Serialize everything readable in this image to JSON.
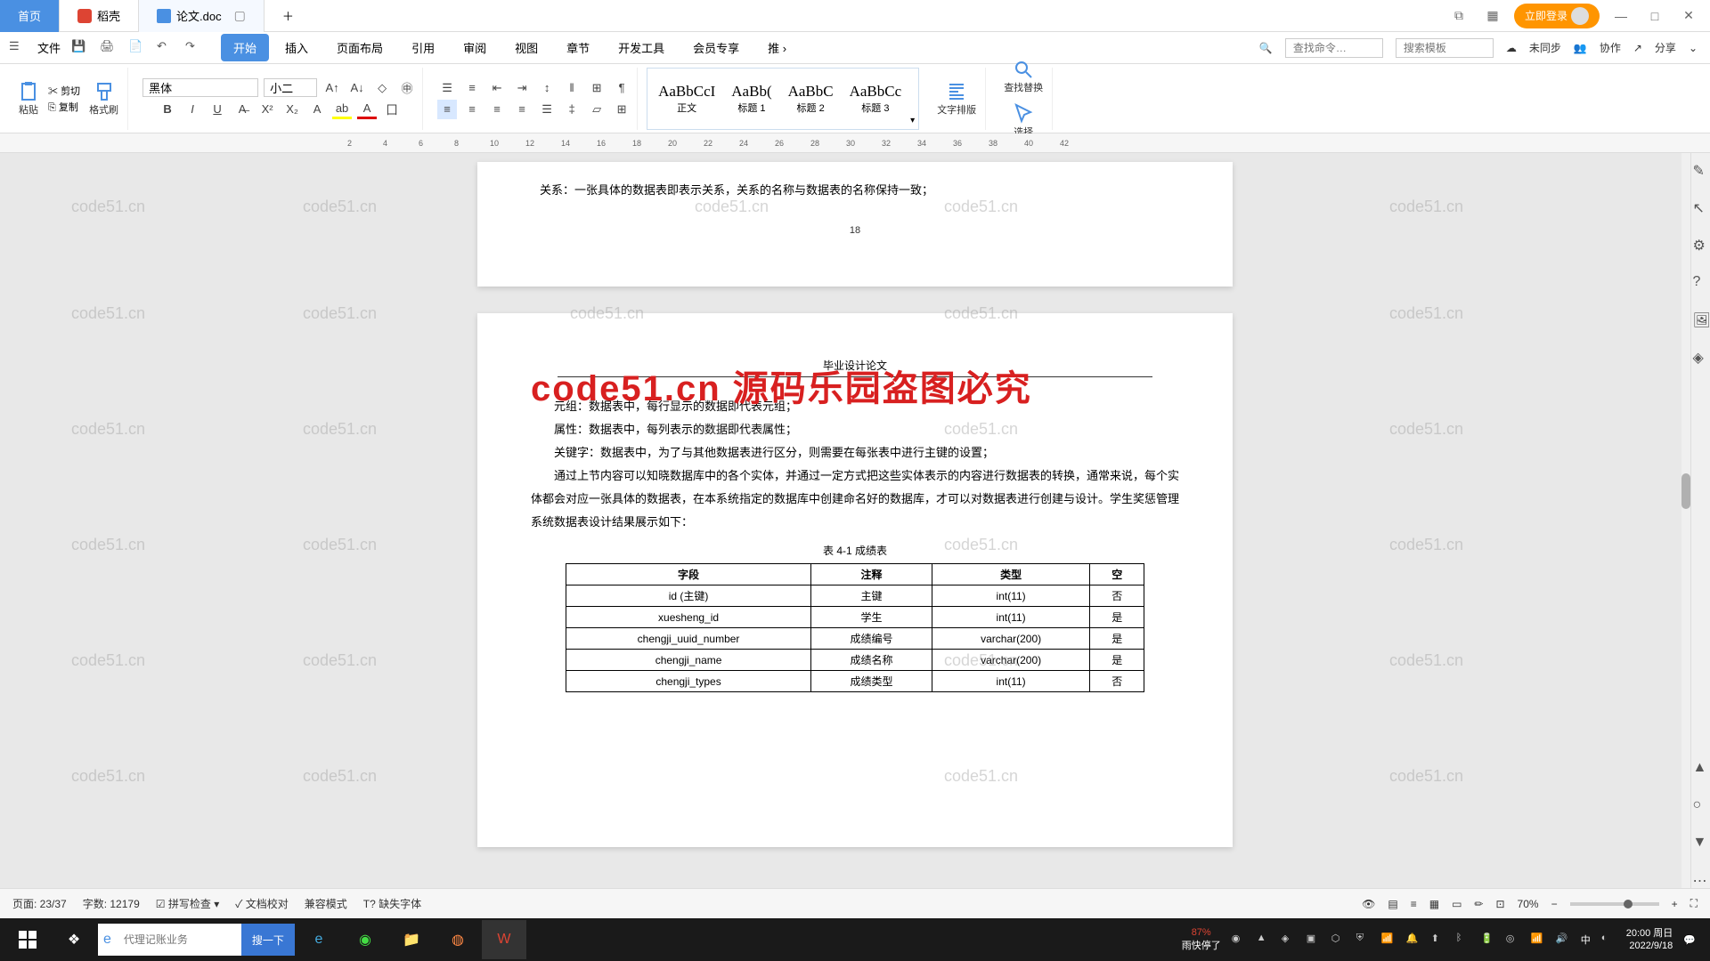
{
  "tabs": {
    "home": "首页",
    "daoke": "稻壳",
    "doc": "论文.doc"
  },
  "titlebar": {
    "login": "立即登录"
  },
  "menubar": {
    "file": "文件",
    "tabs": [
      "开始",
      "插入",
      "页面布局",
      "引用",
      "审阅",
      "视图",
      "章节",
      "开发工具",
      "会员专享",
      "推"
    ],
    "search_cmd_ph": "查找命令…",
    "search_tpl_ph": "搜索模板",
    "unsync": "未同步",
    "coop": "协作",
    "share": "分享"
  },
  "ribbon": {
    "paste": "粘贴",
    "cut": "剪切",
    "copy": "复制",
    "fmt_painter": "格式刷",
    "font": "黑体",
    "size": "小二",
    "styles": [
      {
        "preview": "AaBbCcI",
        "name": "正文"
      },
      {
        "preview": "AaBb(",
        "name": "标题 1"
      },
      {
        "preview": "AaBbC",
        "name": "标题 2"
      },
      {
        "preview": "AaBbCc",
        "name": "标题 3"
      }
    ],
    "text_layout": "文字排版",
    "find_replace": "查找替换",
    "select": "选择"
  },
  "document": {
    "page1_text": "关系：一张具体的数据表即表示关系，关系的名称与数据表的名称保持一致；",
    "page1_num": "18",
    "page2_header": "毕业设计论文",
    "overlay": "code51.cn  源码乐园盗图必究",
    "p1": "元组：数据表中，每行显示的数据即代表元组；",
    "p2": "属性：数据表中，每列表示的数据即代表属性；",
    "p3": "关键字：数据表中，为了与其他数据表进行区分，则需要在每张表中进行主键的设置；",
    "p4": "通过上节内容可以知晓数据库中的各个实体，并通过一定方式把这些实体表示的内容进行数据表的转换，通常来说，每个实体都会对应一张具体的数据表，在本系统指定的数据库中创建命名好的数据库，才可以对数据表进行创建与设计。学生奖惩管理系统数据表设计结果展示如下：",
    "table_caption": "表 4-1  成绩表",
    "table": {
      "headers": [
        "字段",
        "注释",
        "类型",
        "空"
      ],
      "rows": [
        [
          "id (主键)",
          "主键",
          "int(11)",
          "否"
        ],
        [
          "xuesheng_id",
          "学生",
          "int(11)",
          "是"
        ],
        [
          "chengji_uuid_number",
          "成绩编号",
          "varchar(200)",
          "是"
        ],
        [
          "chengji_name",
          "成绩名称",
          "varchar(200)",
          "是"
        ],
        [
          "chengji_types",
          "成绩类型",
          "int(11)",
          "否"
        ]
      ]
    }
  },
  "statusbar": {
    "page": "页面: 23/37",
    "words": "字数: 12179",
    "spell": "拼写检查",
    "proof": "文档校对",
    "compat": "兼容模式",
    "missing_font": "缺失字体",
    "zoom": "70%"
  },
  "taskbar": {
    "search_ph": "代理记账业务",
    "search_btn": "搜一下",
    "weather1": "87%",
    "weather2": "雨快停了",
    "ime": "中",
    "time": "20:00 周日",
    "date": "2022/9/18"
  },
  "watermark": "code51.cn"
}
